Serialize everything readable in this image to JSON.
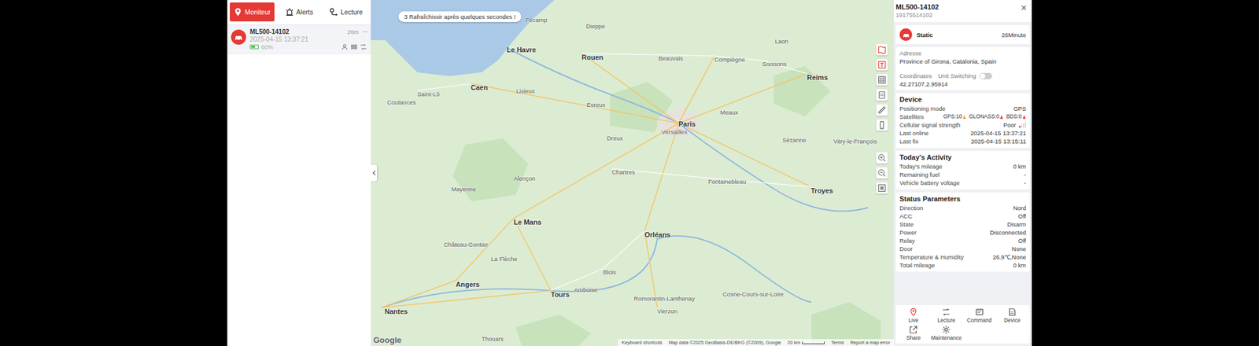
{
  "tabs": [
    {
      "label": "Moniteur",
      "selected": true
    },
    {
      "label": "Alerts",
      "selected": false
    },
    {
      "label": "Lecture",
      "selected": false
    }
  ],
  "device_list": [
    {
      "name": "ML500-14102",
      "time": "2025-04-15 13:37:21",
      "age": "26m",
      "more": "···",
      "battery": "60%",
      "battery_level": 0.6,
      "selected": true
    }
  ],
  "map": {
    "notice": "3 Rafraîchissir après quelques secondes !",
    "labels": [
      {
        "text": "Fécamp",
        "major": false
      },
      {
        "text": "Dieppe",
        "major": false
      },
      {
        "text": "Le Havre",
        "major": true
      },
      {
        "text": "Rouen",
        "major": true
      },
      {
        "text": "Beauvais",
        "major": false
      },
      {
        "text": "Compiègne",
        "major": false
      },
      {
        "text": "Soissons",
        "major": false
      },
      {
        "text": "Laon",
        "major": false
      },
      {
        "text": "Reims",
        "major": true
      },
      {
        "text": "Caen",
        "major": true
      },
      {
        "text": "Lisieux",
        "major": false
      },
      {
        "text": "Évreux",
        "major": false
      },
      {
        "text": "Paris",
        "major": true
      },
      {
        "text": "Versailles",
        "major": false
      },
      {
        "text": "Meaux",
        "major": false
      },
      {
        "text": "Dreux",
        "major": false
      },
      {
        "text": "Chartres",
        "major": false
      },
      {
        "text": "Fontainebleau",
        "major": false
      },
      {
        "text": "Sézanne",
        "major": false
      },
      {
        "text": "Troyes",
        "major": true
      },
      {
        "text": "Vitry-le-François",
        "major": false
      },
      {
        "text": "Saint-Lô",
        "major": false
      },
      {
        "text": "Coutances",
        "major": false
      },
      {
        "text": "Alençon",
        "major": false
      },
      {
        "text": "Mayenne",
        "major": false
      },
      {
        "text": "Le Mans",
        "major": true
      },
      {
        "text": "Château-Gontier",
        "major": false
      },
      {
        "text": "La Flèche",
        "major": false
      },
      {
        "text": "Orléans",
        "major": true
      },
      {
        "text": "Angers",
        "major": true
      },
      {
        "text": "Amboise",
        "major": false
      },
      {
        "text": "Tours",
        "major": true
      },
      {
        "text": "Blois",
        "major": false
      },
      {
        "text": "Romorantin-Lanthenay",
        "major": false
      },
      {
        "text": "Cosne-Cours-sur-Loire",
        "major": false
      },
      {
        "text": "Vierzon",
        "major": false
      },
      {
        "text": "Nantes",
        "major": true
      },
      {
        "text": "Thouars",
        "major": false
      }
    ],
    "footer": {
      "logo": "Google",
      "shortcuts": "Keyboard shortcuts",
      "attribution": "Map data ©2025 GeoBasis-DE/BKG (©2009), Google",
      "scale": "20 km",
      "terms": "Terms",
      "report": "Report a map error"
    }
  },
  "detail": {
    "name": "ML500-14102",
    "imei": "19175514102",
    "close": "×",
    "status": "Static",
    "duration": "26Minute",
    "address_label": "Adresse",
    "address": "Province of Girona, Catalonia, Spain",
    "coordinates_label": "Coordinates",
    "unit_switch": {
      "label": "Unit Switching",
      "on": false
    },
    "coordinates": "42.27107,2.95914",
    "sections": [
      {
        "title": "Device",
        "rows": [
          {
            "kind": "text",
            "label": "Positioning mode",
            "value": "GPS"
          },
          {
            "kind": "satellites",
            "label": "Satellites",
            "items": [
              {
                "text": "GPS:10",
                "color": "#f39c12"
              },
              {
                "text": "GLONASS:0",
                "color": "#e53935"
              },
              {
                "text": "BDS:0",
                "color": "#e53935"
              }
            ]
          },
          {
            "kind": "signal",
            "label": "Cellular signal strength",
            "value": "Poor",
            "level": 0.25,
            "color": "#e53935"
          },
          {
            "kind": "text",
            "label": "Last online",
            "value": "2025-04-15 13:37:21"
          },
          {
            "kind": "text",
            "label": "Last fix",
            "value": "2025-04-15 13:15:11"
          }
        ]
      },
      {
        "title": "Today's Activity",
        "rows": [
          {
            "kind": "text",
            "label": "Today's mileage",
            "value": "0 km"
          },
          {
            "kind": "text",
            "label": "Remaining fuel",
            "value": "-"
          },
          {
            "kind": "text",
            "label": "Vehicle battery voltage",
            "value": "-"
          }
        ]
      },
      {
        "title": "Status Parameters",
        "rows": [
          {
            "kind": "text",
            "label": "Direction",
            "value": "Nord"
          },
          {
            "kind": "text",
            "label": "ACC",
            "value": "Off"
          },
          {
            "kind": "text",
            "label": "State",
            "value": "Disarm"
          },
          {
            "kind": "text",
            "label": "Power",
            "value": "Disconnected"
          },
          {
            "kind": "text",
            "label": "Relay",
            "value": "Off"
          },
          {
            "kind": "text",
            "label": "Door",
            "value": "None"
          },
          {
            "kind": "text",
            "label": "Temperature & Humidity",
            "value": "26.9℃,None"
          },
          {
            "kind": "text",
            "label": "Total mileage",
            "value": "0 km"
          }
        ]
      }
    ],
    "actions": [
      {
        "label": "Live",
        "selected": true
      },
      {
        "label": "Lecture",
        "selected": false
      },
      {
        "label": "Command",
        "selected": false
      },
      {
        "label": "Device",
        "selected": false
      },
      {
        "label": "Share",
        "selected": false
      },
      {
        "label": "Maintenance",
        "selected": false
      }
    ]
  }
}
